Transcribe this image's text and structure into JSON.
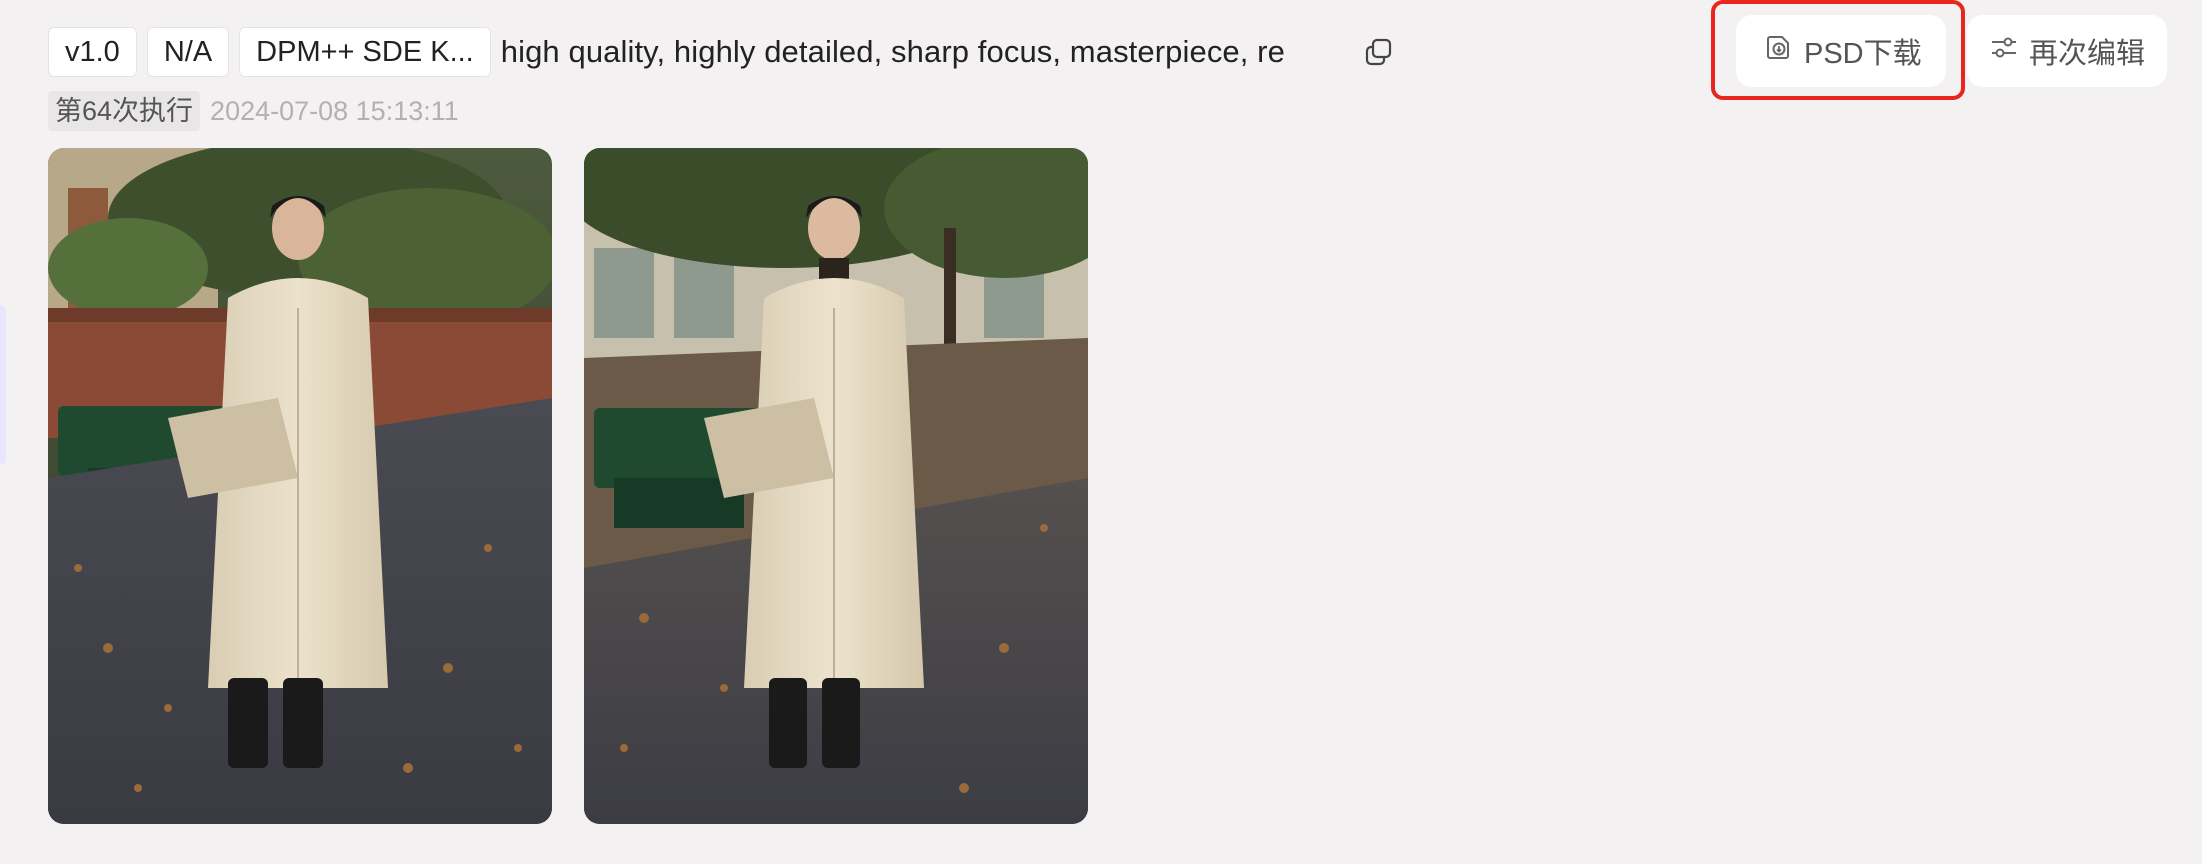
{
  "record": {
    "version": "v1.0",
    "na_tag": "N/A",
    "sampler": "DPM++ SDE K...",
    "prompt": "high quality, highly detailed, sharp focus, masterpiece, re",
    "run_label": "第64次执行",
    "timestamp": "2024-07-08 15:13:11"
  },
  "actions": {
    "psd_download": "PSD下载",
    "re_edit": "再次编辑"
  },
  "icons": {
    "copy": "copy-icon",
    "download": "download-icon",
    "settings": "sliders-icon"
  },
  "images": [
    {
      "name": "generated-image-1"
    },
    {
      "name": "generated-image-2"
    }
  ],
  "colors": {
    "background": "#f4f1f2",
    "highlight": "#e8261c"
  }
}
